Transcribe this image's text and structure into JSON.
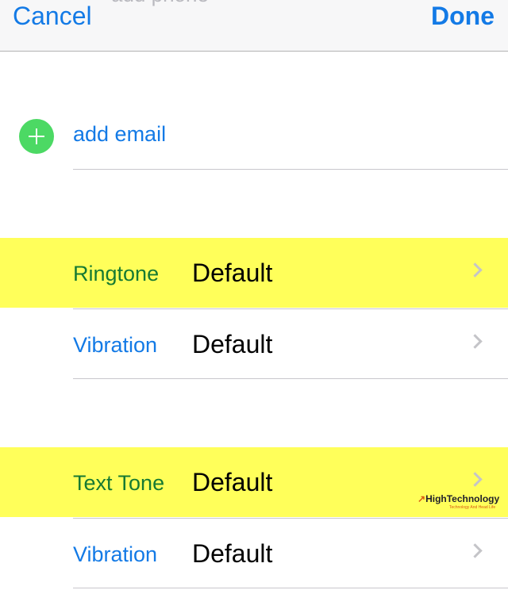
{
  "nav": {
    "ghost_title": "add phone",
    "cancel": "Cancel",
    "done": "Done"
  },
  "add_email": {
    "label": "add email",
    "icon": "plus-circle-icon"
  },
  "sound_group_1": [
    {
      "label": "Ringtone",
      "value": "Default",
      "highlighted": true
    },
    {
      "label": "Vibration",
      "value": "Default",
      "highlighted": false
    }
  ],
  "sound_group_2": [
    {
      "label": "Text Tone",
      "value": "Default",
      "highlighted": true
    },
    {
      "label": "Vibration",
      "value": "Default",
      "highlighted": false
    }
  ],
  "watermark": {
    "title": "HighTechnology",
    "subtitle": "Technology And Head Life"
  },
  "colors": {
    "accent": "#137ae6",
    "highlight": "#ffff5a",
    "highlight_label": "#167a32",
    "add_green": "#4cd964",
    "separator": "#c8c7cc"
  }
}
